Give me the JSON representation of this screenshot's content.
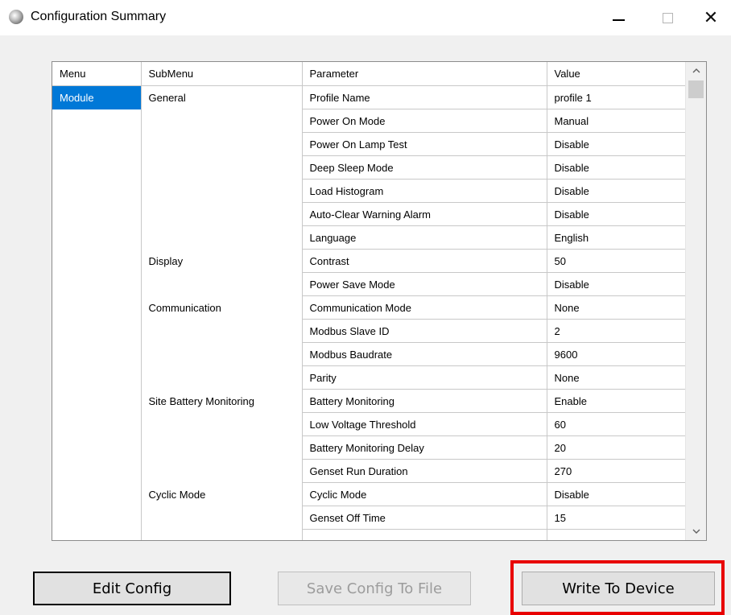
{
  "window": {
    "title": "Configuration Summary",
    "minimize_glyph": "—",
    "maximize_glyph": "☐",
    "close_glyph": "✕",
    "app_icon": "app-logo-icon"
  },
  "table": {
    "headers": {
      "menu": "Menu",
      "submenu": "SubMenu",
      "parameter": "Parameter",
      "value": "Value"
    },
    "rows": [
      {
        "menu": "Module",
        "submenu": "General",
        "parameter": "Profile Name",
        "value": "profile 1"
      },
      {
        "menu": "",
        "submenu": "",
        "parameter": "Power On Mode",
        "value": "Manual"
      },
      {
        "menu": "",
        "submenu": "",
        "parameter": "Power On Lamp Test",
        "value": "Disable"
      },
      {
        "menu": "",
        "submenu": "",
        "parameter": "Deep Sleep Mode",
        "value": "Disable"
      },
      {
        "menu": "",
        "submenu": "",
        "parameter": "Load Histogram",
        "value": "Disable"
      },
      {
        "menu": "",
        "submenu": "",
        "parameter": "Auto-Clear Warning Alarm",
        "value": "Disable"
      },
      {
        "menu": "",
        "submenu": "",
        "parameter": "Language",
        "value": "English"
      },
      {
        "menu": "",
        "submenu": "Display",
        "parameter": "Contrast",
        "value": "50"
      },
      {
        "menu": "",
        "submenu": "",
        "parameter": "Power Save Mode",
        "value": "Disable"
      },
      {
        "menu": "",
        "submenu": "Communication",
        "parameter": "Communication Mode",
        "value": "None"
      },
      {
        "menu": "",
        "submenu": "",
        "parameter": "Modbus Slave ID",
        "value": "2"
      },
      {
        "menu": "",
        "submenu": "",
        "parameter": "Modbus Baudrate",
        "value": "9600"
      },
      {
        "menu": "",
        "submenu": "",
        "parameter": "Parity",
        "value": "None"
      },
      {
        "menu": "",
        "submenu": "Site Battery Monitoring",
        "parameter": "Battery Monitoring",
        "value": "Enable"
      },
      {
        "menu": "",
        "submenu": "",
        "parameter": "Low Voltage Threshold",
        "value": "60"
      },
      {
        "menu": "",
        "submenu": "",
        "parameter": "Battery Monitoring Delay",
        "value": "20"
      },
      {
        "menu": "",
        "submenu": "",
        "parameter": "Genset Run Duration",
        "value": "270"
      },
      {
        "menu": "",
        "submenu": "Cyclic Mode",
        "parameter": "Cyclic Mode",
        "value": "Disable"
      },
      {
        "menu": "",
        "submenu": "",
        "parameter": "Genset Off Time",
        "value": "15"
      },
      {
        "menu": "",
        "submenu": "",
        "parameter": "",
        "value": ""
      }
    ],
    "selected_row": 0
  },
  "scrollbar": {
    "up_glyph": "⌃",
    "down_glyph": "⌄"
  },
  "buttons": {
    "edit_config": "Edit Config",
    "save_config": "Save Config To File",
    "write_device": "Write To Device"
  },
  "colors": {
    "selection": "#0078d7",
    "highlight_box": "#e80000",
    "disabled_text": "#9c9c9c"
  }
}
